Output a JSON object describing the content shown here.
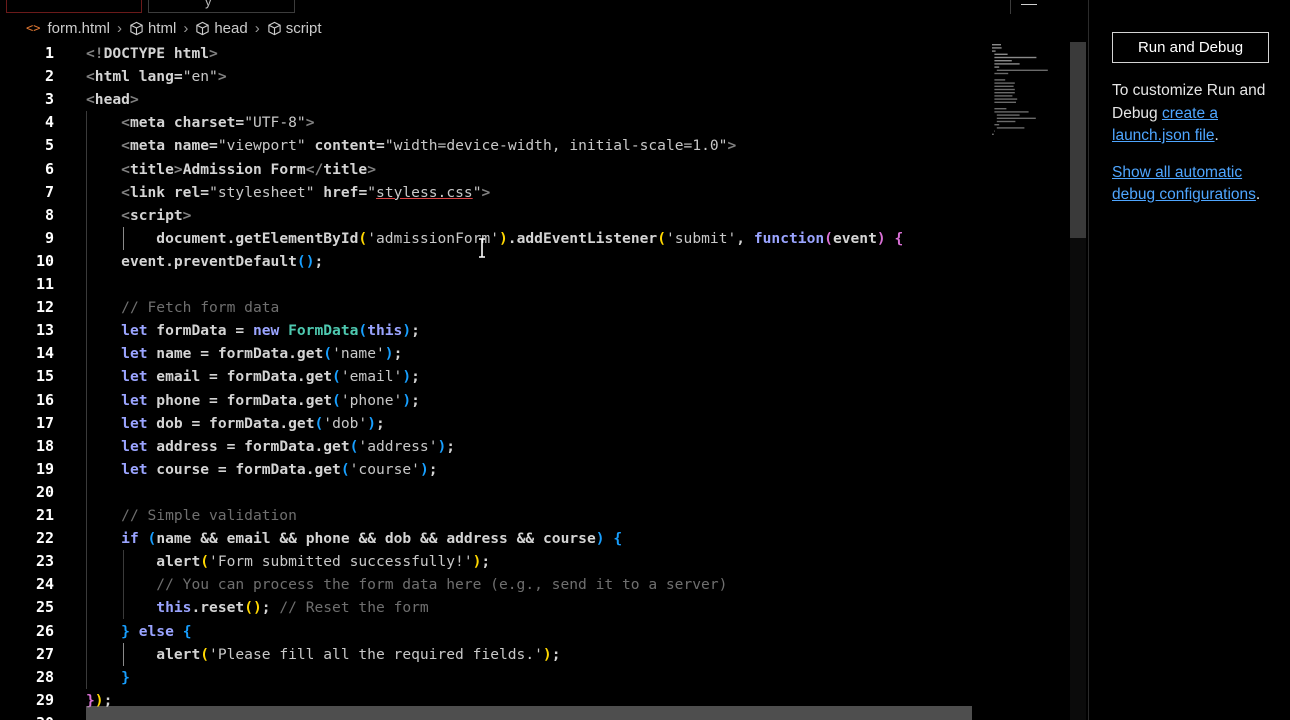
{
  "tabs": {
    "second_label": "y"
  },
  "breadcrumb": {
    "file_icon": "<>",
    "file": "form.html",
    "items": [
      "html",
      "head",
      "script"
    ]
  },
  "code_lines": [
    [
      [
        "t-tag",
        "<!"
      ],
      [
        "t-name",
        "DOCTYPE html"
      ],
      [
        "t-tag",
        ">"
      ]
    ],
    [
      [
        "t-tag",
        "<"
      ],
      [
        "t-name",
        "html"
      ],
      [
        "t-attr",
        " lang"
      ],
      [
        "t-punc",
        "="
      ],
      [
        "t-str",
        "\"en\""
      ],
      [
        "t-tag",
        ">"
      ]
    ],
    [
      [
        "t-tag",
        "<"
      ],
      [
        "t-name",
        "head"
      ],
      [
        "t-tag",
        ">"
      ]
    ],
    [
      [
        "t-punc",
        "    "
      ],
      [
        "t-tag",
        "<"
      ],
      [
        "t-name",
        "meta"
      ],
      [
        "t-attr",
        " charset"
      ],
      [
        "t-punc",
        "="
      ],
      [
        "t-str",
        "\"UTF-8\""
      ],
      [
        "t-tag",
        ">"
      ]
    ],
    [
      [
        "t-punc",
        "    "
      ],
      [
        "t-tag",
        "<"
      ],
      [
        "t-name",
        "meta"
      ],
      [
        "t-attr",
        " name"
      ],
      [
        "t-punc",
        "="
      ],
      [
        "t-str",
        "\"viewport\""
      ],
      [
        "t-attr",
        " content"
      ],
      [
        "t-punc",
        "="
      ],
      [
        "t-str",
        "\"width=device-width, initial-scale=1.0\""
      ],
      [
        "t-tag",
        ">"
      ]
    ],
    [
      [
        "t-punc",
        "    "
      ],
      [
        "t-tag",
        "<"
      ],
      [
        "t-name",
        "title"
      ],
      [
        "t-tag",
        ">"
      ],
      [
        "t-name",
        "Admission Form"
      ],
      [
        "t-tag",
        "</"
      ],
      [
        "t-name",
        "title"
      ],
      [
        "t-tag",
        ">"
      ]
    ],
    [
      [
        "t-punc",
        "    "
      ],
      [
        "t-tag",
        "<"
      ],
      [
        "t-name",
        "link"
      ],
      [
        "t-attr",
        " rel"
      ],
      [
        "t-punc",
        "="
      ],
      [
        "t-str",
        "\"stylesheet\""
      ],
      [
        "t-attr",
        " href"
      ],
      [
        "t-punc",
        "="
      ],
      [
        "t-str",
        "\""
      ],
      [
        "t-str t-link",
        "styless.css"
      ],
      [
        "t-str",
        "\""
      ],
      [
        "t-tag",
        ">"
      ]
    ],
    [
      [
        "t-punc",
        "    "
      ],
      [
        "t-tag",
        "<"
      ],
      [
        "t-name",
        "script"
      ],
      [
        "t-tag",
        ">"
      ]
    ],
    [
      [
        "t-punc",
        "        "
      ],
      [
        "t-var",
        "document"
      ],
      [
        "t-punc",
        "."
      ],
      [
        "t-fn",
        "getElementById"
      ],
      [
        "t-br1",
        "("
      ],
      [
        "t-str",
        "'admissionForm'"
      ],
      [
        "t-br1",
        ")"
      ],
      [
        "t-punc",
        "."
      ],
      [
        "t-fn",
        "addEventListener"
      ],
      [
        "t-br1",
        "("
      ],
      [
        "t-str",
        "'submit'"
      ],
      [
        "t-punc",
        ", "
      ],
      [
        "t-kw2",
        "function"
      ],
      [
        "t-br2",
        "("
      ],
      [
        "t-var",
        "event"
      ],
      [
        "t-br2",
        ")"
      ],
      [
        "t-punc",
        " "
      ],
      [
        "t-br2",
        "{"
      ]
    ],
    [
      [
        "t-punc",
        "    "
      ],
      [
        "t-var",
        "event"
      ],
      [
        "t-punc",
        "."
      ],
      [
        "t-fn",
        "preventDefault"
      ],
      [
        "t-br3",
        "()"
      ],
      [
        "t-punc",
        ";"
      ]
    ],
    [],
    [
      [
        "t-punc",
        "    "
      ],
      [
        "t-cmt",
        "// Fetch form data"
      ]
    ],
    [
      [
        "t-punc",
        "    "
      ],
      [
        "t-kw2",
        "let"
      ],
      [
        "t-var",
        " formData"
      ],
      [
        "t-punc",
        " = "
      ],
      [
        "t-kw2",
        "new"
      ],
      [
        "t-punc",
        " "
      ],
      [
        "t-cls",
        "FormData"
      ],
      [
        "t-br3",
        "("
      ],
      [
        "t-this",
        "this"
      ],
      [
        "t-br3",
        ")"
      ],
      [
        "t-punc",
        ";"
      ]
    ],
    [
      [
        "t-punc",
        "    "
      ],
      [
        "t-kw2",
        "let"
      ],
      [
        "t-var",
        " name"
      ],
      [
        "t-punc",
        " = "
      ],
      [
        "t-var",
        "formData"
      ],
      [
        "t-punc",
        "."
      ],
      [
        "t-fn",
        "get"
      ],
      [
        "t-br3",
        "("
      ],
      [
        "t-str",
        "'name'"
      ],
      [
        "t-br3",
        ")"
      ],
      [
        "t-punc",
        ";"
      ]
    ],
    [
      [
        "t-punc",
        "    "
      ],
      [
        "t-kw2",
        "let"
      ],
      [
        "t-var",
        " email"
      ],
      [
        "t-punc",
        " = "
      ],
      [
        "t-var",
        "formData"
      ],
      [
        "t-punc",
        "."
      ],
      [
        "t-fn",
        "get"
      ],
      [
        "t-br3",
        "("
      ],
      [
        "t-str",
        "'email'"
      ],
      [
        "t-br3",
        ")"
      ],
      [
        "t-punc",
        ";"
      ]
    ],
    [
      [
        "t-punc",
        "    "
      ],
      [
        "t-kw2",
        "let"
      ],
      [
        "t-var",
        " phone"
      ],
      [
        "t-punc",
        " = "
      ],
      [
        "t-var",
        "formData"
      ],
      [
        "t-punc",
        "."
      ],
      [
        "t-fn",
        "get"
      ],
      [
        "t-br3",
        "("
      ],
      [
        "t-str",
        "'phone'"
      ],
      [
        "t-br3",
        ")"
      ],
      [
        "t-punc",
        ";"
      ]
    ],
    [
      [
        "t-punc",
        "    "
      ],
      [
        "t-kw2",
        "let"
      ],
      [
        "t-var",
        " dob"
      ],
      [
        "t-punc",
        " = "
      ],
      [
        "t-var",
        "formData"
      ],
      [
        "t-punc",
        "."
      ],
      [
        "t-fn",
        "get"
      ],
      [
        "t-br3",
        "("
      ],
      [
        "t-str",
        "'dob'"
      ],
      [
        "t-br3",
        ")"
      ],
      [
        "t-punc",
        ";"
      ]
    ],
    [
      [
        "t-punc",
        "    "
      ],
      [
        "t-kw2",
        "let"
      ],
      [
        "t-var",
        " address"
      ],
      [
        "t-punc",
        " = "
      ],
      [
        "t-var",
        "formData"
      ],
      [
        "t-punc",
        "."
      ],
      [
        "t-fn",
        "get"
      ],
      [
        "t-br3",
        "("
      ],
      [
        "t-str",
        "'address'"
      ],
      [
        "t-br3",
        ")"
      ],
      [
        "t-punc",
        ";"
      ]
    ],
    [
      [
        "t-punc",
        "    "
      ],
      [
        "t-kw2",
        "let"
      ],
      [
        "t-var",
        " course"
      ],
      [
        "t-punc",
        " = "
      ],
      [
        "t-var",
        "formData"
      ],
      [
        "t-punc",
        "."
      ],
      [
        "t-fn",
        "get"
      ],
      [
        "t-br3",
        "("
      ],
      [
        "t-str",
        "'course'"
      ],
      [
        "t-br3",
        ")"
      ],
      [
        "t-punc",
        ";"
      ]
    ],
    [],
    [
      [
        "t-punc",
        "    "
      ],
      [
        "t-cmt",
        "// Simple validation"
      ]
    ],
    [
      [
        "t-punc",
        "    "
      ],
      [
        "t-kw2",
        "if"
      ],
      [
        "t-punc",
        " "
      ],
      [
        "t-br3",
        "("
      ],
      [
        "t-var",
        "name"
      ],
      [
        "t-punc",
        " && "
      ],
      [
        "t-var",
        "email"
      ],
      [
        "t-punc",
        " && "
      ],
      [
        "t-var",
        "phone"
      ],
      [
        "t-punc",
        " && "
      ],
      [
        "t-var",
        "dob"
      ],
      [
        "t-punc",
        " && "
      ],
      [
        "t-var",
        "address"
      ],
      [
        "t-punc",
        " && "
      ],
      [
        "t-var",
        "course"
      ],
      [
        "t-br3",
        ")"
      ],
      [
        "t-punc",
        " "
      ],
      [
        "t-br3",
        "{"
      ]
    ],
    [
      [
        "t-punc",
        "        "
      ],
      [
        "t-fn",
        "alert"
      ],
      [
        "t-br1",
        "("
      ],
      [
        "t-str",
        "'Form submitted successfully!'"
      ],
      [
        "t-br1",
        ")"
      ],
      [
        "t-punc",
        ";"
      ]
    ],
    [
      [
        "t-punc",
        "        "
      ],
      [
        "t-cmt",
        "// You can process the form data here (e.g., send it to a server)"
      ]
    ],
    [
      [
        "t-punc",
        "        "
      ],
      [
        "t-this",
        "this"
      ],
      [
        "t-punc",
        "."
      ],
      [
        "t-fn",
        "reset"
      ],
      [
        "t-br1",
        "()"
      ],
      [
        "t-punc",
        "; "
      ],
      [
        "t-cmt",
        "// Reset the form"
      ]
    ],
    [
      [
        "t-punc",
        "    "
      ],
      [
        "t-br3",
        "}"
      ],
      [
        "t-kw2",
        " else"
      ],
      [
        "t-punc",
        " "
      ],
      [
        "t-br3",
        "{"
      ]
    ],
    [
      [
        "t-punc",
        "        "
      ],
      [
        "t-fn",
        "alert"
      ],
      [
        "t-br1",
        "("
      ],
      [
        "t-str",
        "'Please fill all the required fields.'"
      ],
      [
        "t-br1",
        ")"
      ],
      [
        "t-punc",
        ";"
      ]
    ],
    [
      [
        "t-punc",
        "    "
      ],
      [
        "t-br3",
        "}"
      ]
    ],
    [
      [
        "t-br2",
        "}"
      ],
      [
        "t-br1",
        ")"
      ],
      [
        "t-punc",
        ";"
      ]
    ],
    []
  ],
  "sidebar": {
    "run_debug_label": "Run and Debug",
    "customize_text": "To customize Run and Debug ",
    "create_link": "create a launch.json file",
    "period1": ".",
    "show_all_link": "Show all automatic debug configurations",
    "period2": "."
  },
  "colors": {
    "accent_link": "#4fa6ff",
    "background": "#000000",
    "line_numbers": "#ffffff"
  }
}
